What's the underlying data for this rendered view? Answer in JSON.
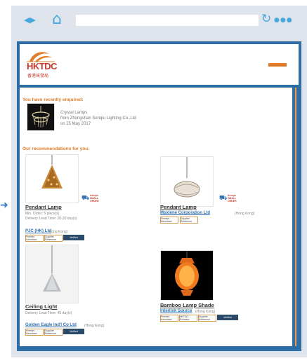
{
  "toolbar": {
    "nav_icon": "back-forward-icon",
    "home_icon": "home-icon",
    "reload_icon": "reload-icon",
    "menu_icon": "more-icon",
    "back_glyph": "◀",
    "forward_glyph": "▶",
    "home_glyph": "⌂",
    "reload_glyph": "↻",
    "menu_glyph": "●●●"
  },
  "colors": {
    "brand_blue": "#2e6ea7",
    "accent_orange": "#e07c2a",
    "toolbar_icon": "#43a9df",
    "frame_bg": "#dfe4ec"
  },
  "header": {
    "logo_text": "HKTDC",
    "logo_subtext": "香港貿發局",
    "menu_icon": "hamburger-icon"
  },
  "enquiry": {
    "heading": "You have recently enquired:",
    "product": "Crystal Lamps",
    "supplier": "from Zhongshan Senqiu Lighting Co.,Ltd",
    "date": "on 25 May 2017"
  },
  "recommendations": {
    "heading": "Our recommendations for you:",
    "accept_label": "Accept SMALL ORDER",
    "items": [
      {
        "title": "Pendant Lamp",
        "min_order": "Min. Order: 5 piece(s)",
        "lead_time": "Delivery Lead Time: 20-30 day(s)",
        "supplier": "PJC (HK) Ltd",
        "region": "(Hong Kong)",
        "badges": [
          "Premier Advertiser",
          "Supplier Reference",
          "Verified"
        ]
      },
      {
        "title": "Pendant Lamp",
        "supplier": "Moxlene Corporation Ltd",
        "region": "(Hong Kong)",
        "badges": [
          "Premier Advertiser",
          "Supplier Reference"
        ]
      },
      {
        "title": "Ceiling Light",
        "lead_time": "Delivery Lead Time: 45 day(s)",
        "supplier": "Golden Eagle Ind'l Co Ltd",
        "region": "(Hong Kong)",
        "badges": [
          "Premier Advertiser",
          "Supplier Reference",
          "Verified"
        ]
      },
      {
        "title": "Bamboo Lamp Shade",
        "supplier": "Interlink Source",
        "region": "(Hong Kong)",
        "badges": [
          "Premier Advertiser",
          "HKTDC Exhibitor",
          "Supplier Reference",
          "Verified"
        ]
      }
    ]
  }
}
